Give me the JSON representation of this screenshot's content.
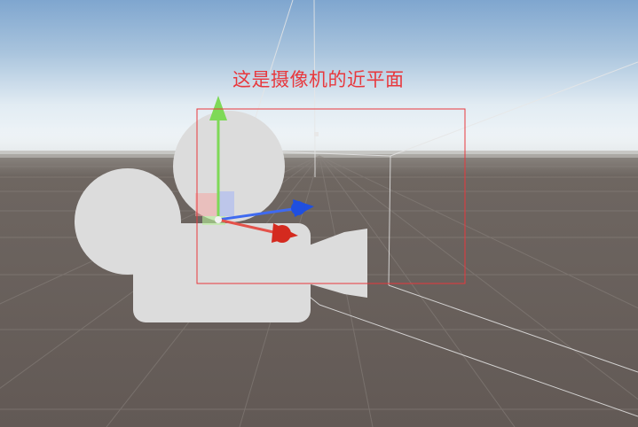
{
  "annotation": {
    "text": "这是摄像机的近平面",
    "color": "#e8383d"
  },
  "scene": {
    "sky_top_color": "#7fa6cf",
    "horizon_color": "#eef4f8",
    "ground_color": "#655c57",
    "camera_icon": "camera-gizmo-icon",
    "camera_icon_color": "#dcdcdc"
  },
  "gizmo": {
    "y_axis_color": "#7ed957",
    "z_axis_color": "#1f4fe0",
    "x_axis_color": "#d42a1f",
    "center_color": "#f2f2f2"
  },
  "near_plane_outline_color": "#e8383d",
  "frustum_line_color": "#e6e6e6"
}
